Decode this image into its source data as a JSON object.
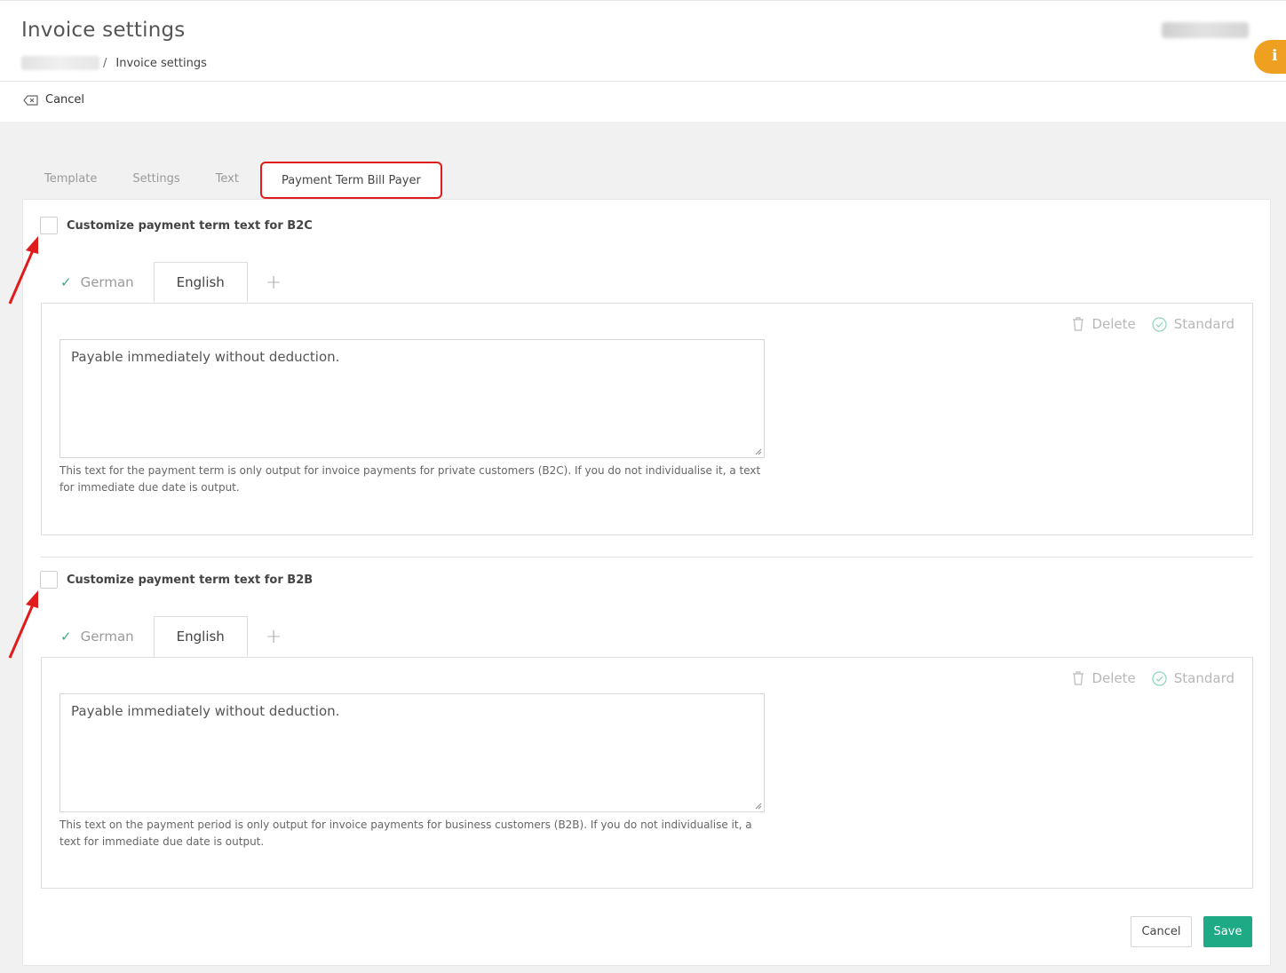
{
  "header": {
    "title": "Invoice settings",
    "breadcrumb": {
      "current": "Invoice settings",
      "separator": "/"
    }
  },
  "info_badge": {
    "label": "i"
  },
  "action_bar": {
    "cancel_label": "Cancel"
  },
  "tabs": [
    {
      "label": "Template",
      "active": false
    },
    {
      "label": "Settings",
      "active": false
    },
    {
      "label": "Text",
      "active": false
    },
    {
      "label": "Payment Term Bill Payer",
      "active": true
    }
  ],
  "sections": [
    {
      "checkbox_label": "Customize payment term text for B2C",
      "checked": false,
      "languages": [
        {
          "label": "German",
          "checked": true,
          "active": false
        },
        {
          "label": "English",
          "checked": false,
          "active": true
        }
      ],
      "add_language": "+",
      "delete_label": "Delete",
      "standard_label": "Standard",
      "text_value": "Payable immediately without deduction.",
      "help_text": "This text for the payment term is only output for invoice payments for private customers (B2C). If you do not individualise it, a text for immediate due date is output."
    },
    {
      "checkbox_label": "Customize payment term text for B2B",
      "checked": false,
      "languages": [
        {
          "label": "German",
          "checked": true,
          "active": false
        },
        {
          "label": "English",
          "checked": false,
          "active": true
        }
      ],
      "add_language": "+",
      "delete_label": "Delete",
      "standard_label": "Standard",
      "text_value": "Payable immediately without deduction.",
      "help_text": "This text on the payment period is only output for invoice payments for business customers (B2B). If you do not individualise it, a text for immediate due date is output."
    }
  ],
  "footer": {
    "cancel_label": "Cancel",
    "save_label": "Save"
  },
  "colors": {
    "accent": "#1daa85",
    "highlight": "#e01b1b",
    "badge": "#f0a020"
  }
}
